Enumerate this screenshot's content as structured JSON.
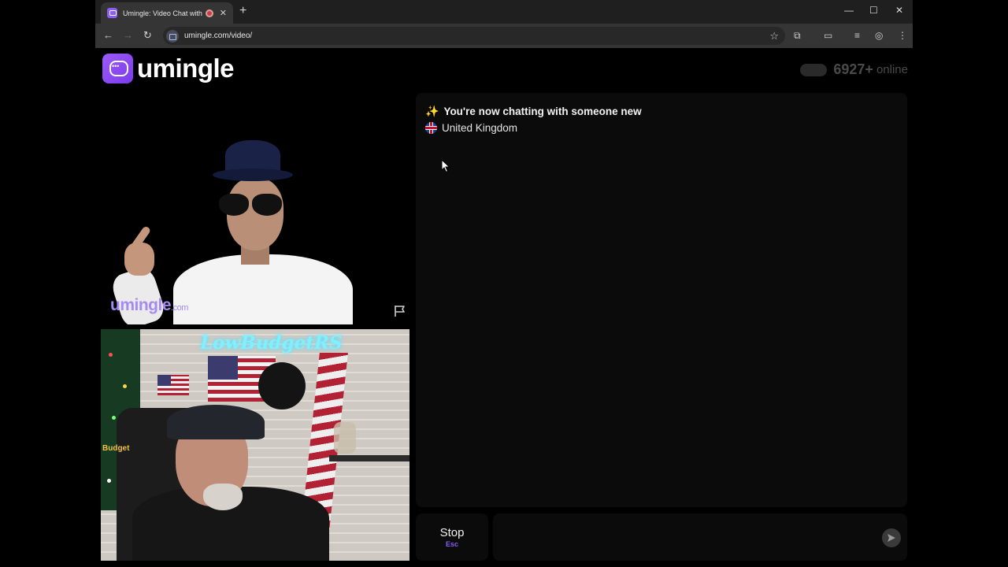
{
  "browser": {
    "tab_title": "Umingle: Video Chat with S",
    "tab_close": "✕",
    "new_tab": "+",
    "url": "umingle.com/video/",
    "controls": {
      "minimize": "—",
      "maximize": "☐",
      "close": "✕"
    }
  },
  "page": {
    "logo_text": "umingle",
    "online_count": "6927+",
    "online_label": "online"
  },
  "remote_video": {
    "watermark": "umingle",
    "watermark_suffix": ".com"
  },
  "local_video": {
    "neon_sign": "LowBudgetRS",
    "chair_label": "Budget"
  },
  "chat": {
    "line1": "You're now chatting with someone new",
    "line2": "United Kingdom"
  },
  "controls": {
    "stop_label": "Stop",
    "stop_key": "Esc",
    "message_placeholder": ""
  },
  "colors": {
    "accent": "#8b5cf6",
    "panel": "#0b0b0b",
    "background": "#000000"
  }
}
